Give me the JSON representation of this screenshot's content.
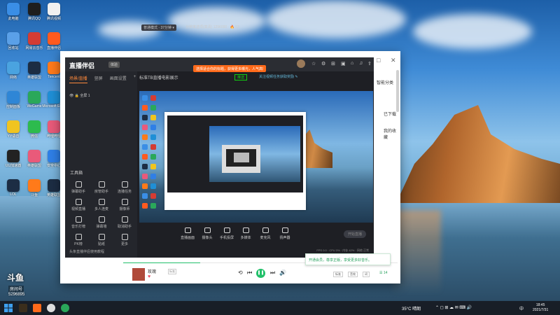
{
  "desktop": {
    "icons": [
      {
        "label": "此电脑",
        "color": "#3a8ee6"
      },
      {
        "label": "腾讯QQ",
        "color": "#1e1e1e"
      },
      {
        "label": "腾讯视频",
        "color": "#f0f0f0"
      },
      {
        "label": "回收站",
        "color": "#5aa0e8"
      },
      {
        "label": "网易云音乐",
        "color": "#d43c33"
      },
      {
        "label": "直播伴侣",
        "color": "#ff5a1f"
      },
      {
        "label": "网络",
        "color": "#4aa3e0"
      },
      {
        "label": "英雄联盟",
        "color": "#1c2d44"
      },
      {
        "label": "Tencent",
        "color": "#ff7a1a"
      },
      {
        "label": "控制面板",
        "color": "#2f86d6"
      },
      {
        "label": "WeGame",
        "color": "#2aa85a"
      },
      {
        "label": "Microsoft Edge",
        "color": "#1f8fd6"
      },
      {
        "label": "YY语音",
        "color": "#f0c420"
      },
      {
        "label": "微信",
        "color": "#2dbb4e"
      },
      {
        "label": "哔哩哔哩",
        "color": "#e95a7a"
      },
      {
        "label": "UU加速器",
        "color": "#222"
      },
      {
        "label": "英雄联盟",
        "color": "#e95a7a"
      },
      {
        "label": "安全中心",
        "color": "#2f7fe6"
      },
      {
        "label": "LOL",
        "color": "#1c2d44"
      },
      {
        "label": "斗鱼",
        "color": "#ff7a1a"
      },
      {
        "label": "英雄联盟",
        "color": "#1c2d44"
      }
    ]
  },
  "window": {
    "controls": [
      "—",
      "□",
      "✕"
    ],
    "side_labels": [
      "智能分类",
      "已下载",
      "我的收藏"
    ]
  },
  "app": {
    "name": "直播伴侣",
    "version": "体验",
    "banner": "选择适合你的标题，获得更多曝光，人气高!",
    "top_icons": [
      "☆",
      "⚙",
      "⊞",
      "▣",
      "⌂",
      "♫",
      "⇪"
    ],
    "tabs": [
      "场景/直播",
      "竖屏",
      "画面设置"
    ],
    "tabs_plus": "+",
    "scene_item": "👁 🔒  全屏 1",
    "toolbox_title": "工具箱",
    "tools": [
      {
        "label": "弹幕助手"
      },
      {
        "label": "房管助手"
      },
      {
        "label": "连播任务"
      },
      {
        "label": "视频直播"
      },
      {
        "label": "多人连麦"
      },
      {
        "label": "摄像师"
      },
      {
        "label": "音乐打榜"
      },
      {
        "label": "弹幕墙"
      },
      {
        "label": "取消助手"
      },
      {
        "label": "PK榜"
      },
      {
        "label": "贴纸"
      },
      {
        "label": "更多"
      }
    ],
    "bottom_hint": "头条直播伴侣使用教程",
    "stage_title": "标准TB直播电影展示",
    "stage_tag_green": "推送",
    "stage_tag_blue": "关注视频任务获取奖励 ✎",
    "mode_a": "普通模式 · 37分钟 ▾",
    "mode_b": "分辨率选项(高清) 1296000 · 🔥 53",
    "actions": [
      {
        "label": "直播画面"
      },
      {
        "label": "摄像头"
      },
      {
        "label": "手机投屏"
      },
      {
        "label": "多媒体"
      },
      {
        "label": "麦克风"
      },
      {
        "label": "扬声器"
      }
    ],
    "start_button": "开始直播",
    "status": "FPS 0.0 · CPU 3% · 内存 42% · 网络 正常"
  },
  "player": {
    "song": "玫瑰",
    "tag": "标准",
    "progress": 0.28,
    "controls": [
      "⟲",
      "⏮",
      "⏭",
      "🔊"
    ],
    "play": "❚❚",
    "right_buttons": [
      "标准",
      "音效",
      "词"
    ],
    "count": "☰ 14",
    "toast": "开通会员，尊享正版，享受更多好音乐。"
  },
  "watermark": {
    "logo": "斗鱼",
    "text": "房间号",
    "id": "5296895"
  },
  "taskbar": {
    "tray_weather": "35°C 晴朗",
    "tray_icons": "⌃ ◻ ⊞ ☁ ✉ ⌨ 🔊",
    "lang": "中",
    "time": "18:45",
    "date": "2021/7/31"
  }
}
